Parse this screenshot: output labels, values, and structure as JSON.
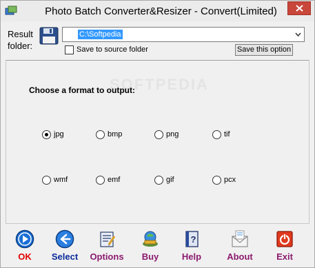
{
  "window": {
    "title": "Photo Batch Converter&Resizer - Convert(Limited)"
  },
  "header": {
    "result_label": "Result\nfolder:",
    "folder_value": "C:\\Softpedia",
    "save_to_source_label": "Save to source folder",
    "save_to_source_checked": false,
    "save_option_label": "Save this option"
  },
  "main": {
    "watermark": "SOFTPEDIA",
    "choose_label": "Choose a format to output:",
    "formats": [
      {
        "label": "jpg",
        "checked": true
      },
      {
        "label": "bmp",
        "checked": false
      },
      {
        "label": "png",
        "checked": false
      },
      {
        "label": "tif",
        "checked": false
      },
      {
        "label": "wmf",
        "checked": false
      },
      {
        "label": "emf",
        "checked": false
      },
      {
        "label": "gif",
        "checked": false
      },
      {
        "label": "pcx",
        "checked": false
      }
    ]
  },
  "toolbar": {
    "buttons": [
      {
        "label": "OK",
        "icon": "ok-icon",
        "color": "#e00000"
      },
      {
        "label": "Select",
        "icon": "back-arrow-icon",
        "color": "#0a2a9a"
      },
      {
        "label": "Options",
        "icon": "options-icon",
        "color": "#8b1a6e"
      },
      {
        "label": "Buy",
        "icon": "buy-icon",
        "color": "#8b1a6e"
      },
      {
        "label": "Help",
        "icon": "help-icon",
        "color": "#8b1a6e"
      },
      {
        "label": "About",
        "icon": "about-icon",
        "color": "#8b1a6e"
      },
      {
        "label": "Exit",
        "icon": "exit-icon",
        "color": "#8b1a6e"
      }
    ]
  }
}
